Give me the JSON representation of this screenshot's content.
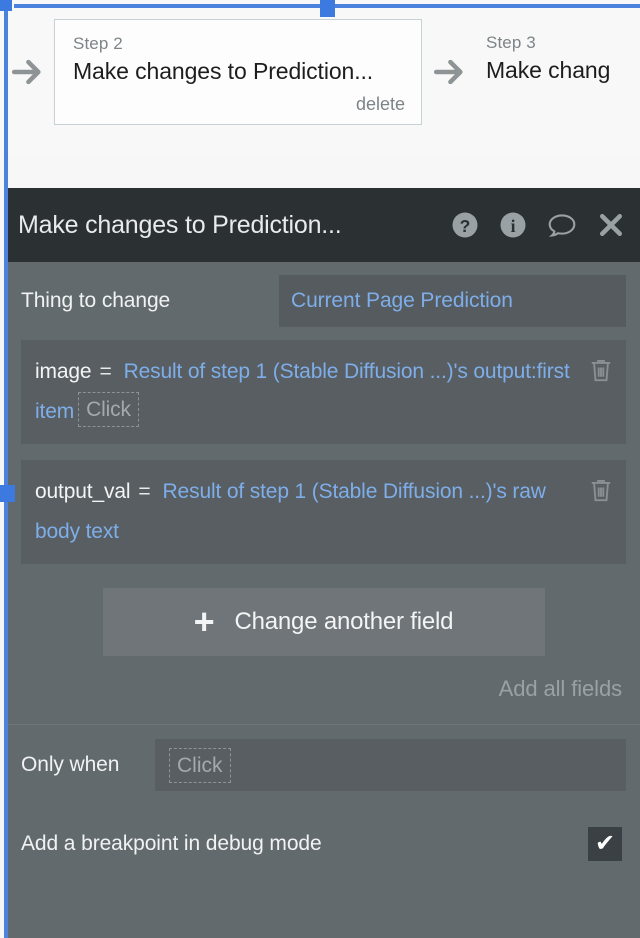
{
  "workflow": {
    "arrow_icon": "arrow-right-icon",
    "steps": [
      {
        "step_label": "Step 2",
        "title": "Make changes to Prediction...",
        "delete_label": "delete"
      },
      {
        "step_label": "Step 3",
        "title": "Make chang"
      }
    ]
  },
  "panel": {
    "title": "Make changes to Prediction...",
    "icons": {
      "help": "question-circle-icon",
      "info": "info-circle-icon",
      "comment": "comment-bubble-icon",
      "close": "close-icon"
    },
    "thing_to_change": {
      "label": "Thing to change",
      "value": "Current Page Prediction"
    },
    "fields": [
      {
        "name": "image",
        "equals": "=",
        "value": "Result of step 1 (Stable Diffusion ...)'s output:first item",
        "placeholder": "Click",
        "has_placeholder": true,
        "delete_icon": "trash-icon"
      },
      {
        "name": "output_val",
        "equals": "=",
        "value": "Result of step 1 (Stable Diffusion ...)'s raw body text",
        "placeholder": "",
        "has_placeholder": false,
        "delete_icon": "trash-icon"
      }
    ],
    "change_another": {
      "icon": "plus-icon",
      "label": "Change another field"
    },
    "add_all_fields": "Add all fields",
    "only_when": {
      "label": "Only when",
      "placeholder": "Click"
    },
    "breakpoint": {
      "label": "Add a breakpoint in debug mode",
      "checked": true,
      "check_glyph": "✔"
    }
  },
  "colors": {
    "accent_blue": "#4a82dd",
    "link_blue": "#7eaeea",
    "panel_bg": "#636a6d",
    "panel_header_bg": "#2b3033",
    "field_bg": "#585e61"
  }
}
